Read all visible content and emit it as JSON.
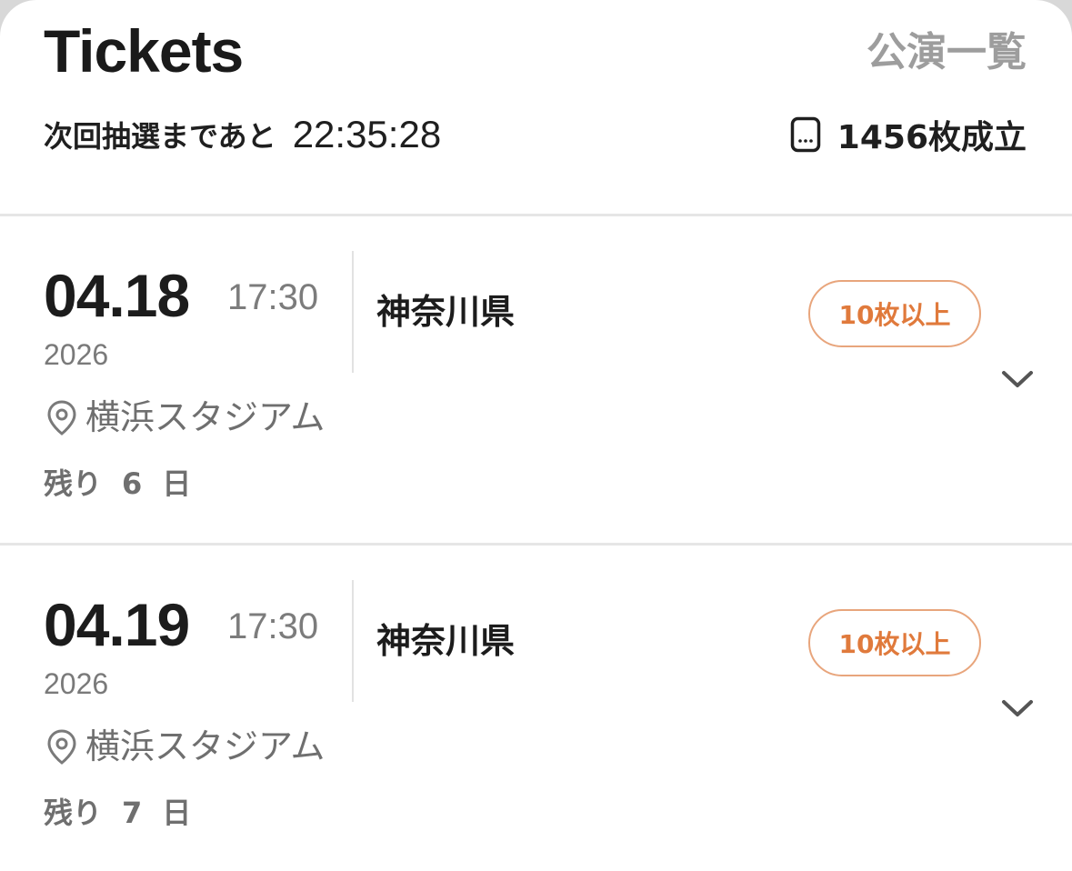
{
  "header": {
    "title": "Tickets",
    "list_link": "公演一覧",
    "draw_label": "次回抽選まであと",
    "draw_countdown": "22:35:28",
    "sold_count": "1456枚成立",
    "ticket_icon": "ticket-icon"
  },
  "events": [
    {
      "date": "04.18",
      "time": "17:30",
      "year": "2026",
      "prefecture": "神奈川県",
      "badge": "10枚以上",
      "venue": "横浜スタジアム",
      "remain_prefix": "残り",
      "remain_days": "6",
      "remain_suffix": "日",
      "pin_icon": "location-pin-icon",
      "chevron_icon": "chevron-down-icon"
    },
    {
      "date": "04.19",
      "time": "17:30",
      "year": "2026",
      "prefecture": "神奈川県",
      "badge": "10枚以上",
      "venue": "横浜スタジアム",
      "remain_prefix": "残り",
      "remain_days": "7",
      "remain_suffix": "日",
      "pin_icon": "location-pin-icon",
      "chevron_icon": "chevron-down-icon"
    }
  ],
  "colors": {
    "accent": "#e07a3c",
    "badge_border": "#e8a57c",
    "muted_text": "#7a7a7a",
    "list_link": "#9d9d9d",
    "divider": "#e6e6e6"
  }
}
